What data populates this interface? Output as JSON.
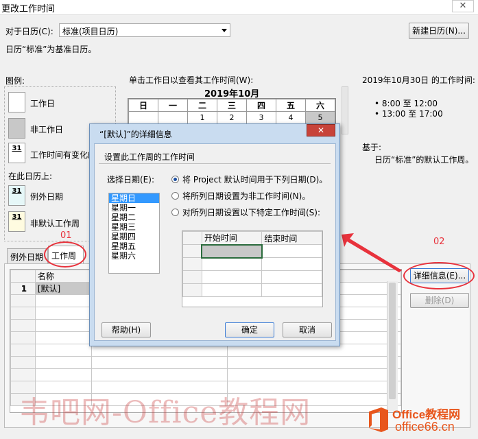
{
  "window": {
    "title": "更改工作时间",
    "close_glyph": "✕"
  },
  "calendar_select": {
    "label": "对于日历(C):",
    "value": "标准(项目日历)"
  },
  "new_calendar_button": "新建日历(N)...",
  "base_note": "日历“标准”为基准日历。",
  "legend": {
    "title": "图例:",
    "working": "工作日",
    "nonworking": "非工作日",
    "edited_num": "31",
    "edited": "工作时间有变化的",
    "on_this_calendar": "在此日历上:",
    "exception_num": "31",
    "exception": "例外日期",
    "nondefault_num": "31",
    "nondefault": "非默认工作周"
  },
  "calendar": {
    "instruction": "单击工作日以查看其工作时间(W):",
    "month": "2019年10月",
    "weekdays": [
      "日",
      "一",
      "二",
      "三",
      "四",
      "五",
      "六"
    ],
    "week1": [
      "",
      "",
      "1",
      "2",
      "3",
      "4",
      "5"
    ]
  },
  "info": {
    "heading": "2019年10月30日 的工作时间:",
    "time1": "8:00 至 12:00",
    "time2": "13:00 至 17:00",
    "based_on": "基于:",
    "based_desc": "日历“标准”的默认工作周。"
  },
  "tabs": {
    "exceptions": "例外日期",
    "work_weeks": "工作周"
  },
  "grid": {
    "col_name": "名称",
    "row1_num": "1",
    "row1_name": "[默认]"
  },
  "right_buttons": {
    "details": "详细信息(E)...",
    "delete": "删除(D)"
  },
  "annotations": {
    "n01": "01",
    "n02": "02",
    "color": "#e8323c"
  },
  "dialog": {
    "title": "“[默认]”的详细信息",
    "section": "设置此工作周的工作时间",
    "select_day_label": "选择日期(E):",
    "days": [
      "星期日",
      "星期一",
      "星期二",
      "星期三",
      "星期四",
      "星期五",
      "星期六"
    ],
    "option1": "将 Project 默认时间用于下列日期(D)。",
    "option2": "将所列日期设置为非工作时间(N)。",
    "option3": "对所列日期设置以下特定工作时间(S):",
    "col_start": "开始时间",
    "col_end": "结束时间",
    "help": "帮助(H)",
    "ok": "确定",
    "cancel": "取消",
    "close_glyph": "✕"
  },
  "watermark": {
    "text": "韦吧网-Office教程网",
    "logo_line1": "Office教程网",
    "logo_line2": "office66.cn"
  }
}
